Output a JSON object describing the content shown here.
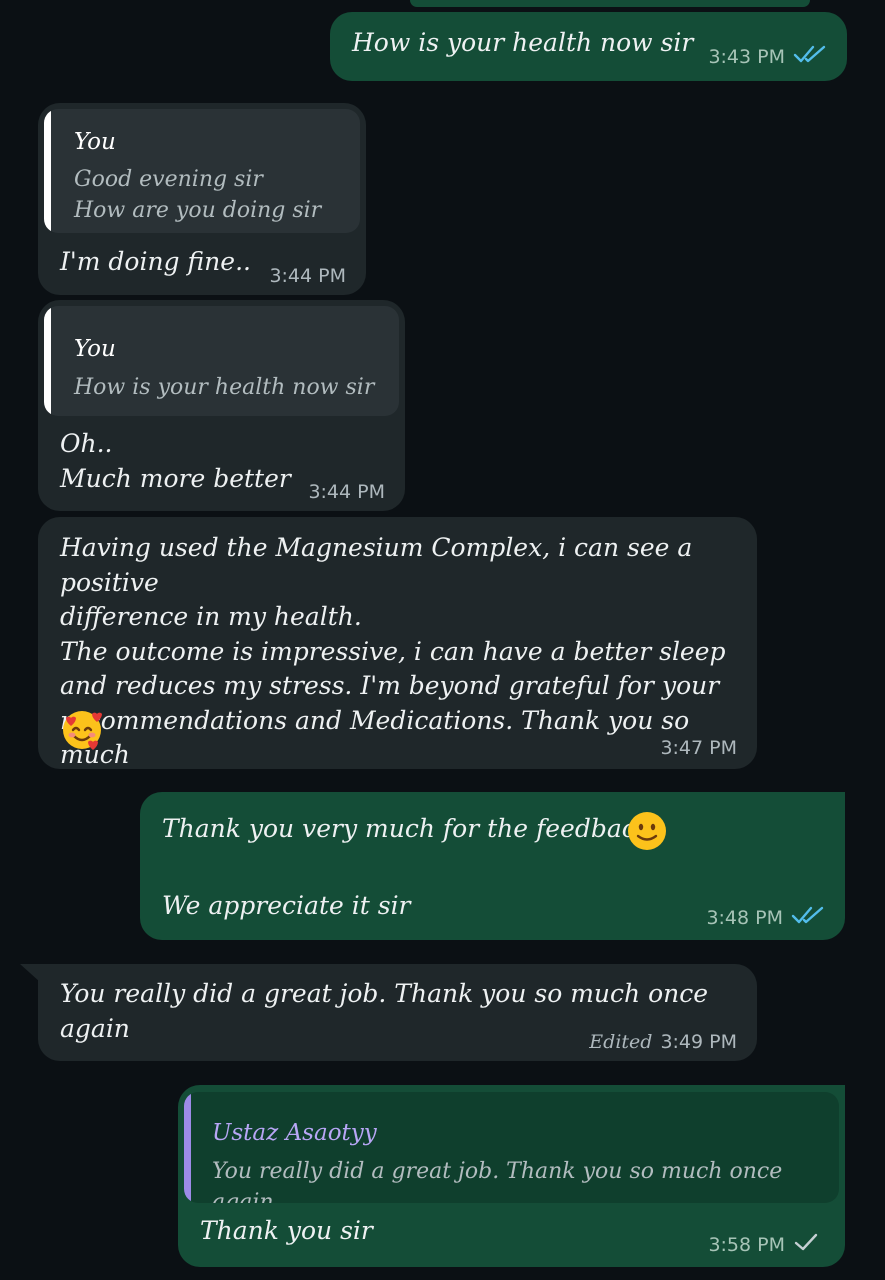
{
  "colors": {
    "outgoing_bubble": "#144d37",
    "incoming_bubble": "#1f272a",
    "read_tick": "#53bdeb",
    "sent_tick": "#c5cfd3",
    "quote_bar_self": "#ffffff",
    "quote_bar_contact": "#9d8be8"
  },
  "messages": [
    {
      "text": "How is your health now sir",
      "time": "3:43 PM",
      "status_icon": "double-check-read-icon"
    },
    {
      "quote_name": "You",
      "quote_text": "Good evening sir\nHow are you doing sir",
      "text": "I'm doing fine..",
      "time": "3:44 PM"
    },
    {
      "quote_name": "You",
      "quote_text": "How is your health now sir",
      "text": "Oh..\nMuch more better",
      "time": "3:44 PM"
    },
    {
      "text": "Having used the Magnesium Complex, i can see a positive\ndifference in my health.\nThe outcome is impressive, i can have a better sleep\nand reduces my stress. I'm beyond grateful for your\nrecommendations and Medications. Thank you so much",
      "emoji": "smiling-face-with-hearts-emoji",
      "time": "3:47 PM"
    },
    {
      "text": "Thank you very much for the feedback",
      "text2": "We appreciate it sir",
      "emoji": "slightly-smiling-face-emoji",
      "time": "3:48 PM",
      "status_icon": "double-check-read-icon"
    },
    {
      "text": "You really did a great job. Thank you so much once\nagain",
      "edited": "Edited",
      "time": "3:49 PM"
    },
    {
      "quote_name": "Ustaz Asaotyy",
      "quote_text": "You really did a great job. Thank you so much once again",
      "text": "Thank you sir",
      "time": "3:58 PM",
      "status_icon": "single-check-sent-icon"
    }
  ]
}
